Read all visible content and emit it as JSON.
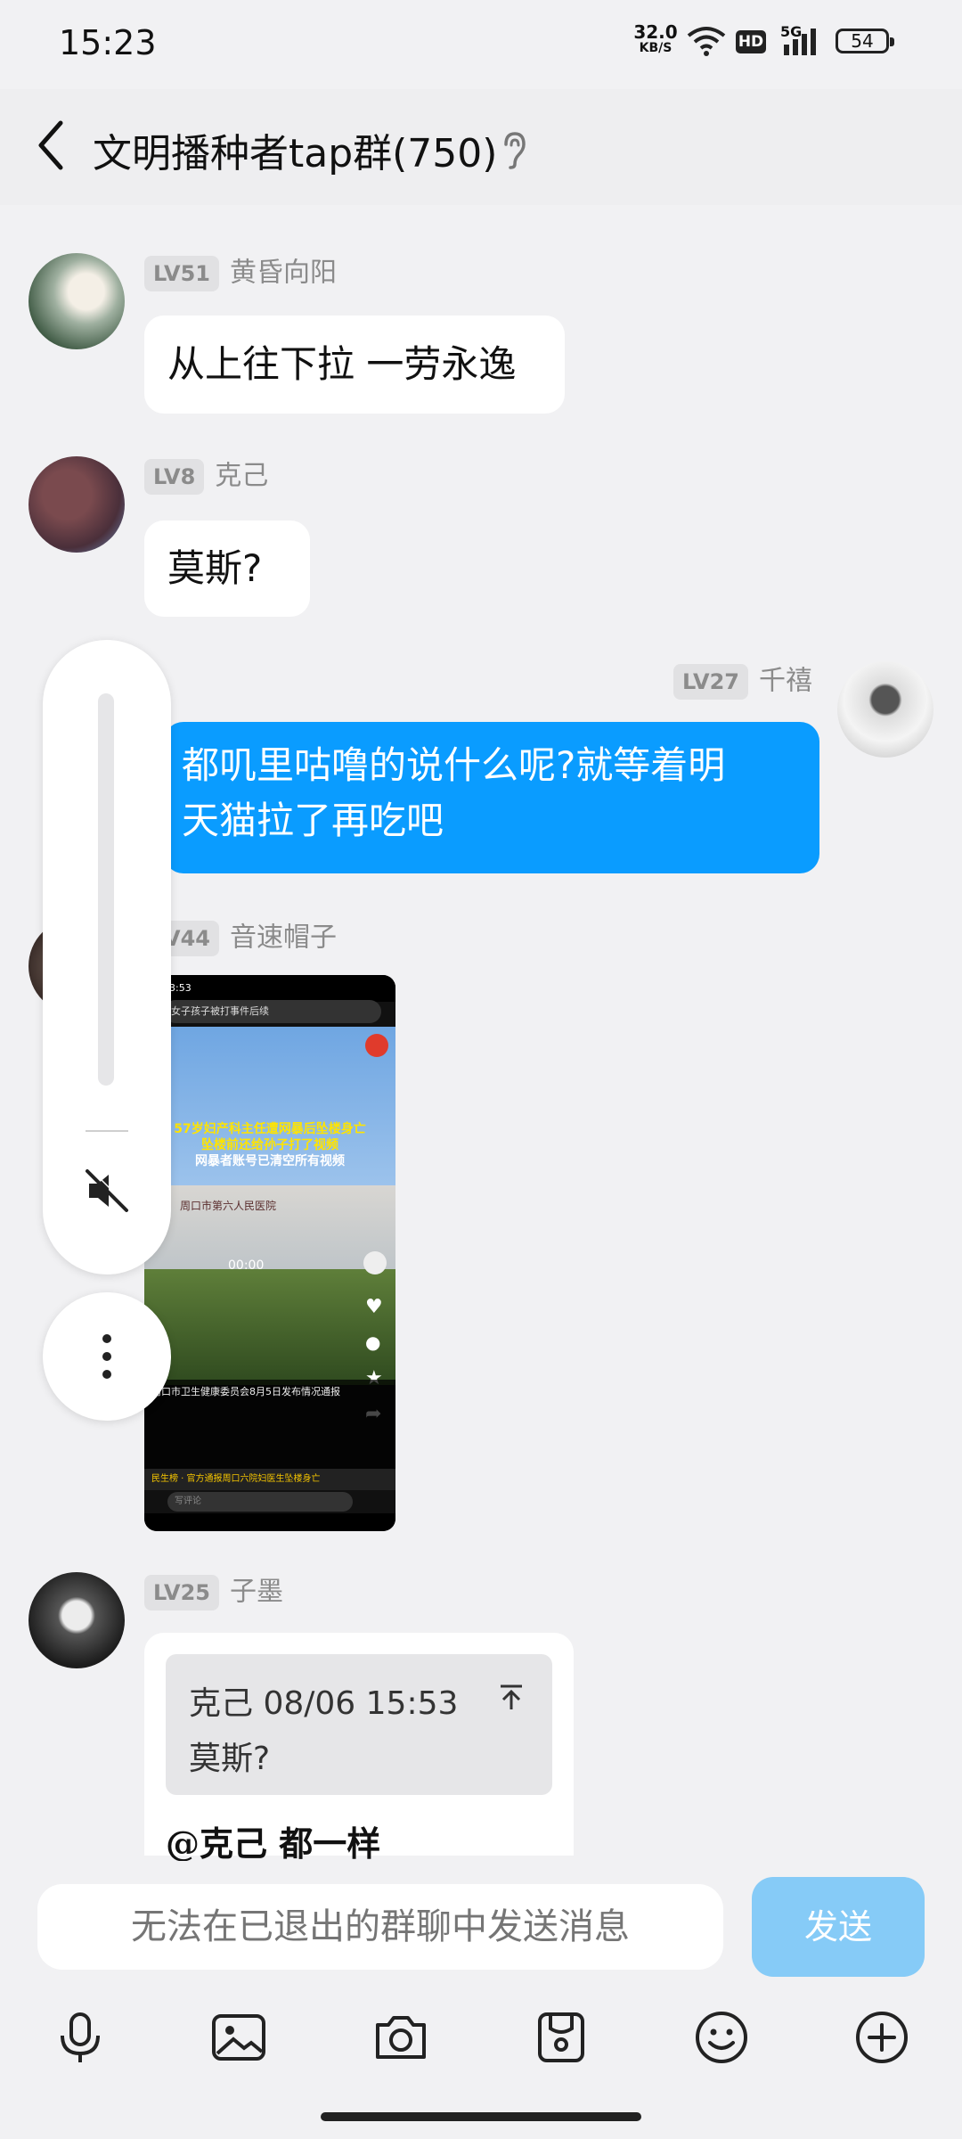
{
  "status": {
    "time": "15:23",
    "net_speed": "32.0",
    "net_unit": "KB/S",
    "hd": "HD",
    "signal": "5G",
    "battery": "54"
  },
  "header": {
    "title": "文明播种者tap群(750)"
  },
  "messages": [
    {
      "level": "LV51",
      "name": "黄昏向阳",
      "text": "从上往下拉 一劳永逸"
    },
    {
      "level": "LV8",
      "name": "克己",
      "text": "莫斯?"
    },
    {
      "level": "LV27",
      "name": "千禧",
      "text_line1": "都叽里咕噜的说什么呢?就等着明",
      "text_line2": "天猫拉了再吃吧"
    },
    {
      "level": "LV44",
      "name": "音速帽子"
    },
    {
      "level": "LV25",
      "name": "子墨",
      "quote_head": "克己 08/06 15:53",
      "quote_body": "莫斯?",
      "mention": "@克己 都一样"
    }
  ],
  "video": {
    "top_time": "3:53",
    "search": "女子孩子被打事件后续",
    "headline1": "57岁妇产科主任遭网暴后坠楼身亡",
    "headline2": "坠楼前还给孙子打了视频",
    "headline3": "网暴者账号已清空所有视频",
    "timer": "00:00",
    "sign": "周口市第六人民医院",
    "caption": "周口市卫生健康委员会8月5日发布情况通报",
    "bottom": "民生榜 · 官方通报周口六院妇医生坠楼身亡",
    "comment_hint": "写评论"
  },
  "input": {
    "placeholder": "无法在已退出的群聊中发送消息",
    "send": "发送"
  },
  "toolbar": [
    "mic-icon",
    "image-icon",
    "camera-icon",
    "sticker-icon",
    "emoji-icon",
    "plus-icon"
  ]
}
